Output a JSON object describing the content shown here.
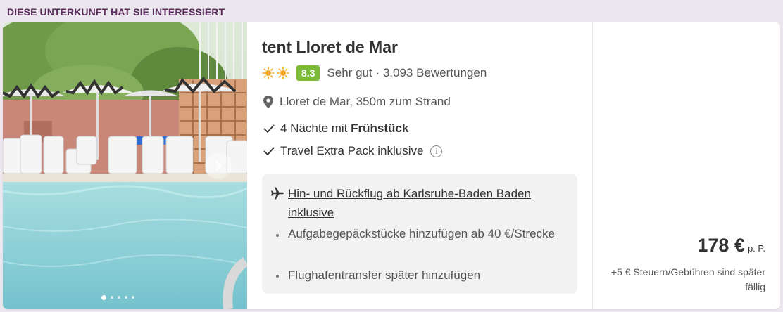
{
  "banner": {
    "label": "DIESE UNTERKUNFT HAT SIE INTERESSIERT"
  },
  "hotel": {
    "name": "tent Lloret de Mar",
    "sun_rating": 2,
    "score": "8.3",
    "rating_text": "Sehr gut · 3.093 Bewertungen",
    "location": "Lloret de Mar, 350m zum Strand"
  },
  "features": {
    "nights_prefix": "4 Nächte mit ",
    "nights_board": "Frühstück",
    "extra_pack": "Travel Extra Pack inklusive"
  },
  "flight": {
    "line": "Hin- und Rückflug ab Karlsruhe-Baden Baden inklusive",
    "baggage": "Aufgabegepäckstücke hinzufügen ab 40 €/Strecke",
    "transfer": "Flughafentransfer später hinzufügen"
  },
  "gallery": {
    "image_count": 5,
    "active_index": 0
  },
  "price": {
    "amount": "178 €",
    "unit": "p. P.",
    "tax_note": "+5 € Steuern/Gebühren sind später fällig"
  },
  "colors": {
    "accent_purple": "#5a2d5c",
    "score_green": "#7dbb3b",
    "sun": "#f5a623"
  }
}
